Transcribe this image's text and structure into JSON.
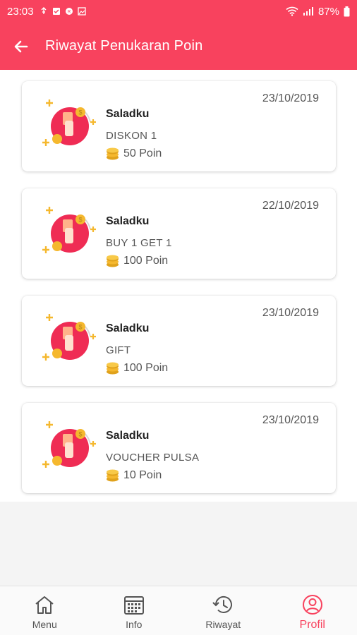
{
  "status_bar": {
    "time": "23:03",
    "battery": "87%"
  },
  "header": {
    "title": "Riwayat Penukaran Poin"
  },
  "colors": {
    "primary": "#f8425e",
    "coin": "#f5b82e"
  },
  "redemptions": [
    {
      "date": "23/10/2019",
      "merchant": "Saladku",
      "item": "DISKON 1",
      "points": "50 Poin"
    },
    {
      "date": "22/10/2019",
      "merchant": "Saladku",
      "item": "BUY 1 GET 1",
      "points": "100 Poin"
    },
    {
      "date": "23/10/2019",
      "merchant": "Saladku",
      "item": "GIFT",
      "points": "100 Poin"
    },
    {
      "date": "23/10/2019",
      "merchant": "Saladku",
      "item": "VOUCHER PULSA",
      "points": "10 Poin"
    }
  ],
  "bottom_nav": {
    "items": [
      {
        "label": "Menu",
        "icon": "home-icon"
      },
      {
        "label": "Info",
        "icon": "calendar-icon"
      },
      {
        "label": "Riwayat",
        "icon": "history-icon"
      },
      {
        "label": "Profil",
        "icon": "profile-icon",
        "active": true
      }
    ]
  }
}
